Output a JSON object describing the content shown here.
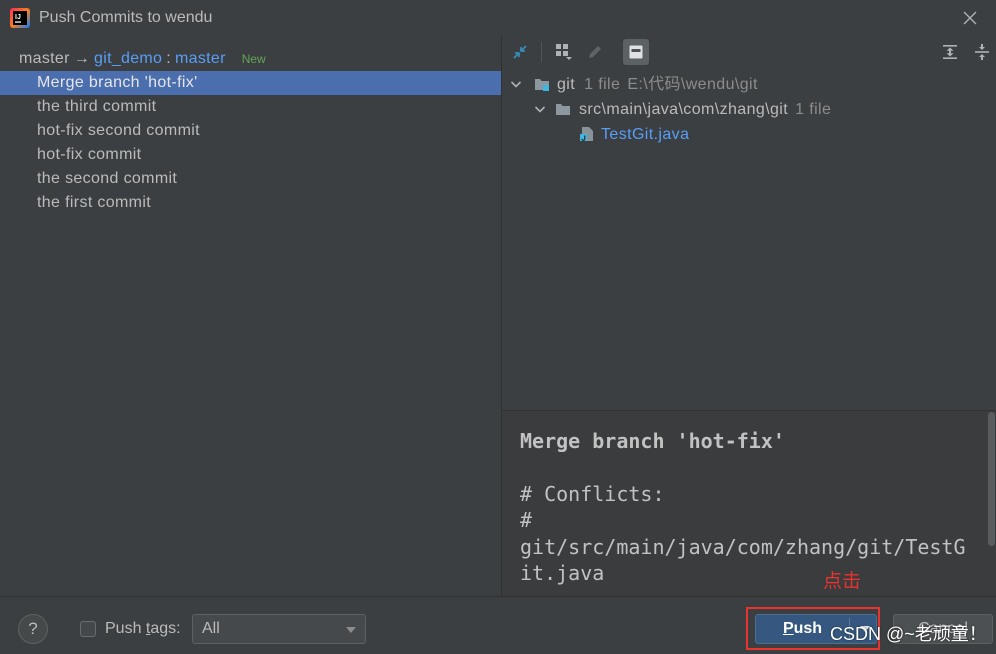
{
  "window": {
    "title": "Push Commits to wendu",
    "app_icon": "intellij-idea-icon",
    "logo_lettering": "IJ",
    "close_icon": "close-icon"
  },
  "colors": {
    "background": "#3c3f41",
    "text": "#bbbbbb",
    "selection": "#4b6eaf",
    "link": "#589df6",
    "secondary_text": "#8c8c8c",
    "badge_new": "#62a35a",
    "primary_button": "#365880",
    "accent_icon": "#3592c4",
    "annotation": "#e8332f",
    "watermark": "#ffffff"
  },
  "commits_panel": {
    "push_target": {
      "local_branch": "master",
      "arrow": "→",
      "remote": "git_demo",
      "separator": ":",
      "remote_branch": "master",
      "badge": "New"
    },
    "commits": [
      {
        "message": "Merge branch 'hot-fix'",
        "selected": true
      },
      {
        "message": "the third commit",
        "selected": false
      },
      {
        "message": "hot-fix second commit",
        "selected": false
      },
      {
        "message": "hot-fix commit",
        "selected": false
      },
      {
        "message": "the second commit",
        "selected": false
      },
      {
        "message": "the first commit",
        "selected": false
      }
    ]
  },
  "changes_panel": {
    "toolbar": {
      "buttons": [
        {
          "icon": "diff-arrows-icon",
          "enabled": true
        },
        {
          "icon": "group-by-icon",
          "enabled": true
        },
        {
          "icon": "edit-source-icon",
          "enabled": false
        },
        {
          "icon": "show-details-icon",
          "enabled": true,
          "pressed": true
        },
        {
          "icon": "expand-all-icon",
          "enabled": true
        },
        {
          "icon": "collapse-all-icon",
          "enabled": true
        }
      ]
    },
    "tree": [
      {
        "label": "git",
        "count": "1 file",
        "path": "E:\\代码\\wendu\\git",
        "icon": "repository-folder-icon",
        "expanded": true
      },
      {
        "label": "src\\main\\java\\com\\zhang\\git",
        "count": "1 file",
        "icon": "folder-icon",
        "expanded": true
      },
      {
        "label": "TestGit.java",
        "icon": "java-file-icon"
      }
    ],
    "details": {
      "lines": [
        "Merge branch 'hot-fix'",
        "",
        "# Conflicts:",
        "#",
        "git/src/main/java/com/zhang/git/TestGit.java"
      ]
    }
  },
  "footer": {
    "help_label": "?",
    "push_tags": {
      "label": "Push tags:",
      "mnemonic": "t",
      "checked": false
    },
    "tags_mode": {
      "value": "All"
    },
    "push_button": {
      "label": "Push",
      "mnemonic": "P"
    },
    "cancel_button": {
      "label": "Cancel"
    }
  },
  "annotation": {
    "label": "点击"
  },
  "watermark": "CSDN @~老顽童！"
}
